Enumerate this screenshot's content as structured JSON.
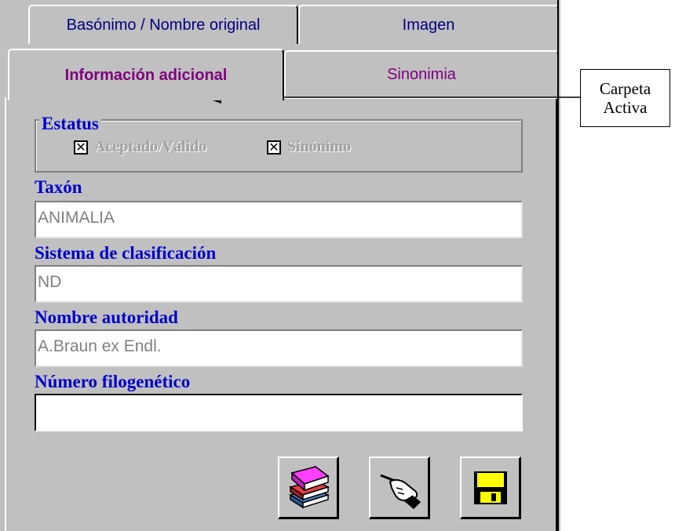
{
  "tabs": {
    "back_row": [
      {
        "label": "Basónimo / Nombre original"
      },
      {
        "label": "Imagen"
      }
    ],
    "front_row": [
      {
        "label": "Información adicional",
        "active": true
      },
      {
        "label": "Sinonimia",
        "active": false
      }
    ]
  },
  "estatus": {
    "title": "Estatus",
    "options": [
      {
        "label": "Aceptado/Válido",
        "checked": true,
        "enabled": false
      },
      {
        "label": "Sinónimo",
        "checked": true,
        "enabled": false
      }
    ]
  },
  "fields": [
    {
      "label": "Taxón",
      "value": "ANIMALIA"
    },
    {
      "label": "Sistema de clasificación",
      "value": "ND"
    },
    {
      "label": "Nombre autoridad",
      "value": "A.Braun ex Endl."
    },
    {
      "label": "Número filogenético",
      "value": ""
    }
  ],
  "buttons": [
    {
      "icon": "books-icon"
    },
    {
      "icon": "hand-pen-icon"
    },
    {
      "icon": "floppy-disk-icon"
    }
  ],
  "callout": {
    "line1": "Carpeta",
    "line2": "Activa"
  },
  "colors": {
    "panel": "#c0c0c0",
    "label_blue": "#0000cc",
    "tab_purple": "#800080",
    "tab_navy": "#000080"
  }
}
